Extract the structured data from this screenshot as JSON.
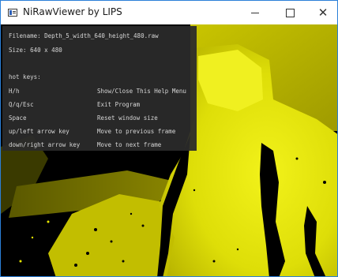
{
  "window": {
    "title": "NiRawViewer by LIPS",
    "icon": "app-window-icon",
    "controls": {
      "minimize": "minimize-icon",
      "maximize": "maximize-icon",
      "close": "close-icon"
    }
  },
  "help": {
    "filename_line": "Filename: Depth_5_width_640_height_480.raw",
    "size_line": "Size: 640 x 480",
    "hotkeys_heading": "hot keys:",
    "keys": [
      {
        "key": "H/h",
        "action": "Show/Close This Help Menu"
      },
      {
        "key": "Q/q/Esc",
        "action": "Exit Program"
      },
      {
        "key": "Space",
        "action": "Reset window size"
      },
      {
        "key": "up/left arrow key",
        "action": "Move to previous frame"
      },
      {
        "key": "down/right arrow key",
        "action": "Move to next frame"
      }
    ]
  },
  "colors": {
    "depth_bright": "#ecec10",
    "depth_mid": "#b8b400",
    "depth_dark": "#5a5800",
    "background": "#000000",
    "window_border": "#2b7fd8"
  }
}
